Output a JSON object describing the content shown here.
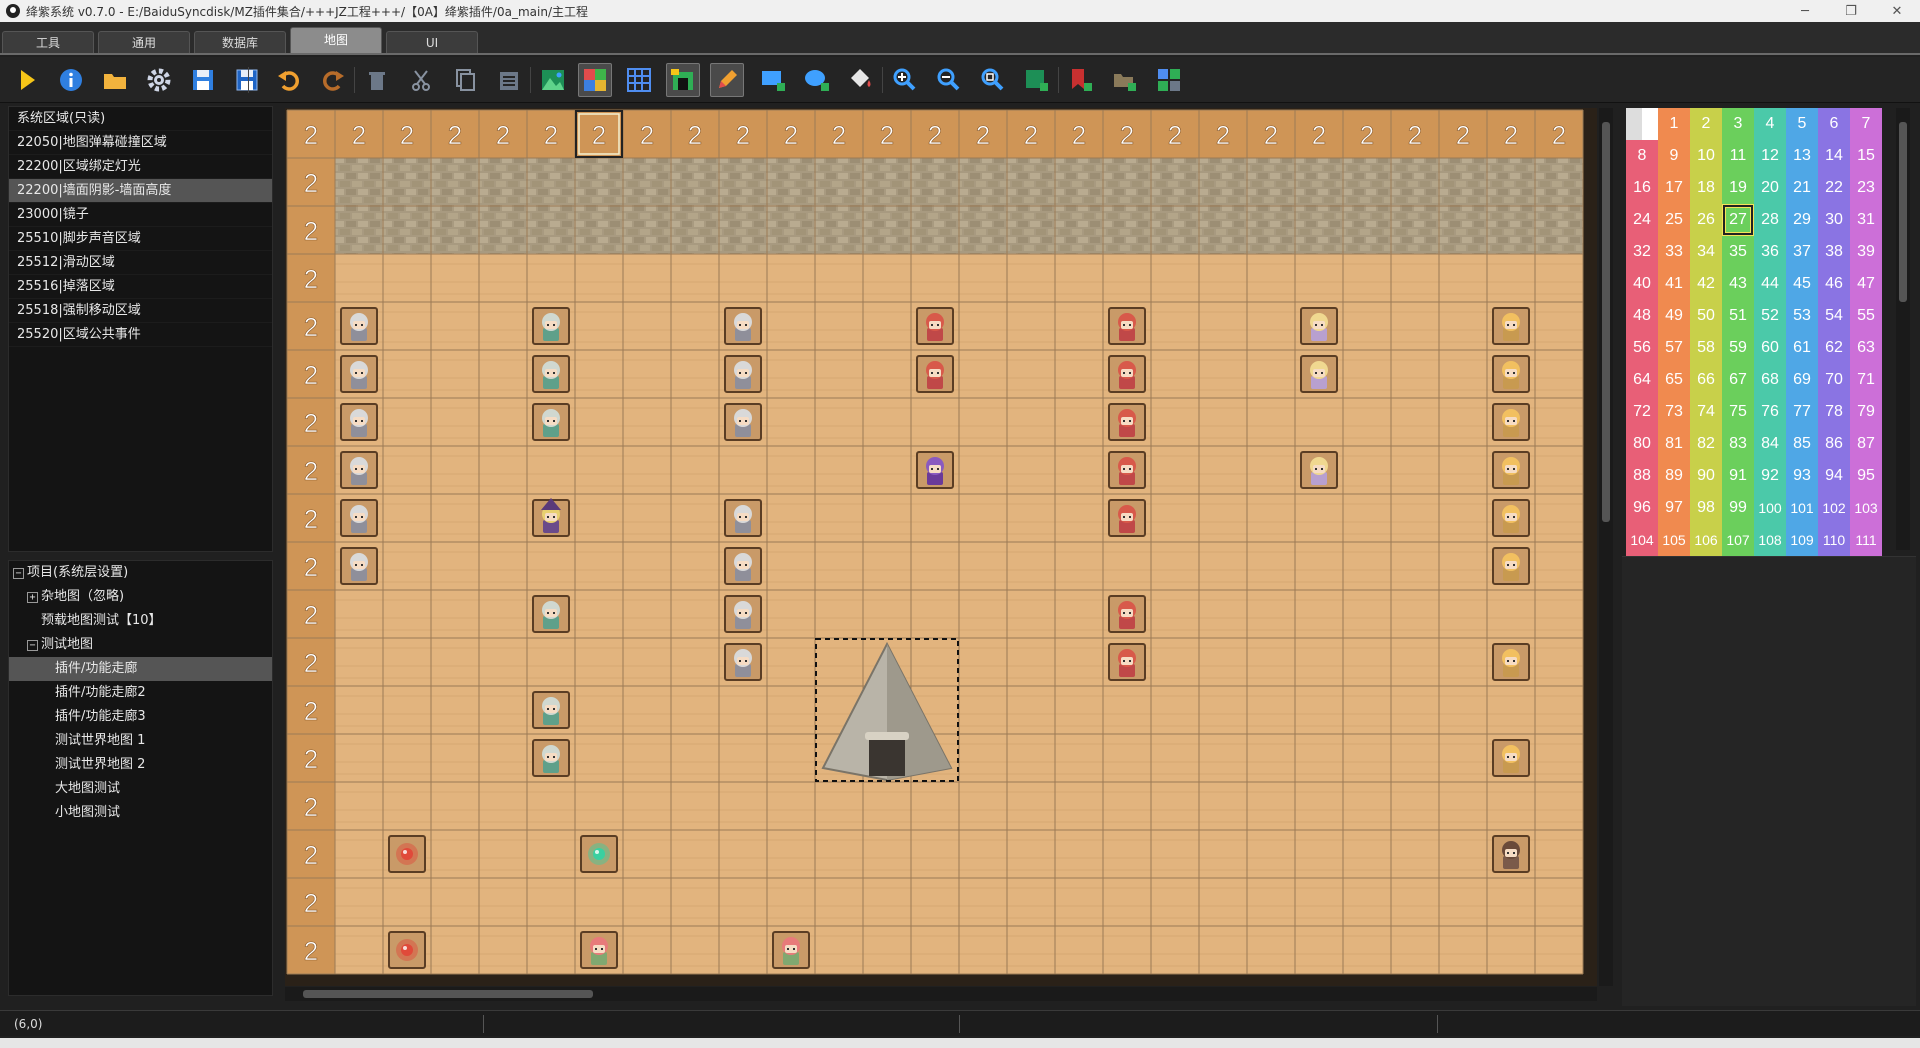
{
  "window": {
    "title": "绛紫系统 v0.7.0 - E:/BaiduSyncdisk/MZ插件集合/+++JZ工程+++/【0A】绛紫插件/0a_main/主工程",
    "min": "─",
    "max": "❐",
    "close": "✕"
  },
  "tabs": [
    {
      "label": "工具"
    },
    {
      "label": "通用"
    },
    {
      "label": "数据库"
    },
    {
      "label": "地图"
    },
    {
      "label": "UI"
    }
  ],
  "active_tab": "地图",
  "toolbar": {
    "icons": [
      "play-icon",
      "info-icon",
      "folder-icon",
      "gear-icon",
      "save-icon",
      "save-as-icon",
      "undo-icon",
      "redo-icon",
      "delete-icon",
      "cut-icon",
      "copy-icon",
      "paste-icon",
      "map-image-icon",
      "number-grid-icon",
      "grid-icon",
      "region-icon",
      "pencil-icon",
      "add-rect-icon",
      "add-ellipse-icon",
      "fill-icon",
      "zoom-in-icon",
      "zoom-out-icon",
      "zoom-reset-icon",
      "new-map-icon",
      "new-event-icon",
      "new-folder-icon",
      "tiles-icon"
    ]
  },
  "region_list": {
    "items": [
      "系统区域(只读)",
      "22050|地图弹幕碰撞区域",
      "22200|区域绑定灯光",
      "22200|墙面阴影-墙面高度",
      "23000|镜子",
      "25510|脚步声音区域",
      "25512|滑动区域",
      "25516|掉落区域",
      "25518|强制移动区域",
      "25520|区域公共事件"
    ],
    "selected": 3
  },
  "map_tree": {
    "items": [
      {
        "label": "项目(系统层设置)",
        "level": 0,
        "expander": "−"
      },
      {
        "label": "杂地图（忽略)",
        "level": 1,
        "expander": "+"
      },
      {
        "label": "预载地图测试【10】",
        "level": 1,
        "expander": ""
      },
      {
        "label": "测试地图",
        "level": 1,
        "expander": "−"
      },
      {
        "label": "插件/功能走廊",
        "level": 2,
        "expander": ""
      },
      {
        "label": "插件/功能走廊2",
        "level": 2,
        "expander": ""
      },
      {
        "label": "插件/功能走廊3",
        "level": 2,
        "expander": ""
      },
      {
        "label": "测试世界地图 1",
        "level": 2,
        "expander": ""
      },
      {
        "label": "测试世界地图 2",
        "level": 2,
        "expander": ""
      },
      {
        "label": "大地图测试",
        "level": 2,
        "expander": ""
      },
      {
        "label": "小地图测试",
        "level": 2,
        "expander": ""
      }
    ],
    "selected": 4
  },
  "map": {
    "region_number": "2",
    "cols": 27,
    "rows": 18,
    "wall_rows": 3,
    "top_row_selected_col": 6,
    "colors": {
      "floor": "#e2b47e",
      "wall": "#a89a80",
      "region_bg": "#cf9556",
      "grid": "#9b7a55"
    },
    "events": [
      {
        "col": 1,
        "row": 4,
        "kind": "elder"
      },
      {
        "col": 1,
        "row": 5,
        "kind": "elder"
      },
      {
        "col": 1,
        "row": 6,
        "kind": "elder"
      },
      {
        "col": 1,
        "row": 7,
        "kind": "elder"
      },
      {
        "col": 1,
        "row": 8,
        "kind": "elder"
      },
      {
        "col": 1,
        "row": 9,
        "kind": "elder"
      },
      {
        "col": 5,
        "row": 4,
        "kind": "knight"
      },
      {
        "col": 5,
        "row": 5,
        "kind": "knight"
      },
      {
        "col": 5,
        "row": 6,
        "kind": "knight"
      },
      {
        "col": 5,
        "row": 8,
        "kind": "witch"
      },
      {
        "col": 5,
        "row": 10,
        "kind": "knight"
      },
      {
        "col": 5,
        "row": 12,
        "kind": "knight"
      },
      {
        "col": 5,
        "row": 13,
        "kind": "knight"
      },
      {
        "col": 9,
        "row": 4,
        "kind": "elder"
      },
      {
        "col": 9,
        "row": 5,
        "kind": "elder"
      },
      {
        "col": 9,
        "row": 6,
        "kind": "elder"
      },
      {
        "col": 9,
        "row": 8,
        "kind": "elder"
      },
      {
        "col": 9,
        "row": 9,
        "kind": "elder"
      },
      {
        "col": 9,
        "row": 10,
        "kind": "elder"
      },
      {
        "col": 9,
        "row": 11,
        "kind": "elder"
      },
      {
        "col": 13,
        "row": 4,
        "kind": "red"
      },
      {
        "col": 13,
        "row": 5,
        "kind": "red"
      },
      {
        "col": 13,
        "row": 7,
        "kind": "purple"
      },
      {
        "col": 17,
        "row": 4,
        "kind": "red"
      },
      {
        "col": 17,
        "row": 5,
        "kind": "red"
      },
      {
        "col": 17,
        "row": 6,
        "kind": "red"
      },
      {
        "col": 17,
        "row": 7,
        "kind": "red"
      },
      {
        "col": 17,
        "row": 8,
        "kind": "red"
      },
      {
        "col": 17,
        "row": 10,
        "kind": "red"
      },
      {
        "col": 17,
        "row": 11,
        "kind": "red"
      },
      {
        "col": 21,
        "row": 4,
        "kind": "blonde"
      },
      {
        "col": 21,
        "row": 5,
        "kind": "blonde"
      },
      {
        "col": 21,
        "row": 7,
        "kind": "blonde"
      },
      {
        "col": 25,
        "row": 4,
        "kind": "gold"
      },
      {
        "col": 25,
        "row": 5,
        "kind": "gold"
      },
      {
        "col": 25,
        "row": 6,
        "kind": "gold"
      },
      {
        "col": 25,
        "row": 7,
        "kind": "gold"
      },
      {
        "col": 25,
        "row": 8,
        "kind": "gold"
      },
      {
        "col": 25,
        "row": 9,
        "kind": "gold"
      },
      {
        "col": 25,
        "row": 11,
        "kind": "gold"
      },
      {
        "col": 25,
        "row": 13,
        "kind": "gold"
      },
      {
        "col": 25,
        "row": 15,
        "kind": "brown"
      },
      {
        "col": 2,
        "row": 15,
        "kind": "orb-red"
      },
      {
        "col": 6,
        "row": 15,
        "kind": "orb-green"
      },
      {
        "col": 2,
        "row": 17,
        "kind": "orb-red"
      },
      {
        "col": 6,
        "row": 17,
        "kind": "girl"
      },
      {
        "col": 10,
        "row": 17,
        "kind": "girl"
      }
    ],
    "tent": {
      "col": 11,
      "row": 11,
      "w": 3,
      "h": 3
    }
  },
  "palette": {
    "numbers": [
      1,
      2,
      3,
      4,
      5,
      6,
      7,
      8,
      9,
      10,
      11,
      12,
      13,
      14,
      15,
      16,
      17,
      18,
      19,
      20,
      21,
      22,
      23,
      24,
      25,
      26,
      27,
      28,
      29,
      30,
      31,
      32,
      33,
      34,
      35,
      36,
      37,
      38,
      39,
      40,
      41,
      42,
      43,
      44,
      45,
      46,
      47,
      48,
      49,
      50,
      51,
      52,
      53,
      54,
      55,
      56,
      57,
      58,
      59,
      60,
      61,
      62,
      63,
      64,
      65,
      66,
      67,
      68,
      69,
      70,
      71,
      72,
      73,
      74,
      75,
      76,
      77,
      78,
      79,
      80,
      81,
      82,
      83,
      84,
      85,
      86,
      87,
      88,
      89,
      90,
      91,
      92,
      93,
      94,
      95,
      96,
      97,
      98,
      99,
      100,
      101,
      102,
      103,
      104,
      105,
      106,
      107,
      108,
      109,
      110,
      111
    ],
    "selected": 27,
    "column_colors": [
      "#e85f77",
      "#f08a4f",
      "#c8d04a",
      "#6bcf5c",
      "#4bc9a9",
      "#4fa7e6",
      "#8a74e3",
      "#cc6fd8"
    ]
  },
  "status": {
    "coords": "(6,0)"
  }
}
